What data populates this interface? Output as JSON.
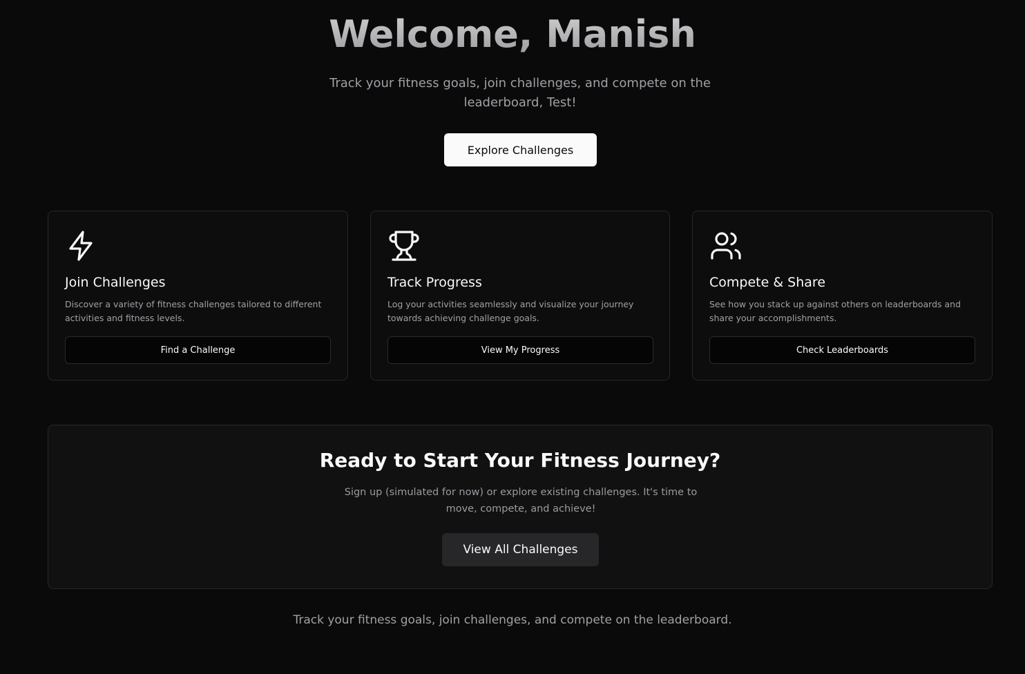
{
  "hero": {
    "title": "Welcome, Manish",
    "subtitle": "Track your fitness goals, join challenges, and compete on the leaderboard, Test!",
    "cta_label": "Explore Challenges"
  },
  "features": [
    {
      "icon": "lightning-icon",
      "title": "Join Challenges",
      "description": "Discover a variety of fitness challenges tailored to different activities and fitness levels.",
      "button_label": "Find a Challenge"
    },
    {
      "icon": "trophy-icon",
      "title": "Track Progress",
      "description": "Log your activities seamlessly and visualize your journey towards achieving challenge goals.",
      "button_label": "View My Progress"
    },
    {
      "icon": "users-icon",
      "title": "Compete & Share",
      "description": "See how you stack up against others on leaderboards and share your accomplishments.",
      "button_label": "Check Leaderboards"
    }
  ],
  "cta": {
    "title": "Ready to Start Your Fitness Journey?",
    "description": "Sign up (simulated for now) or explore existing challenges. It's time to move, compete, and achieve!",
    "button_label": "View All Challenges"
  },
  "footer": {
    "text": "Track your fitness goals, join challenges, and compete on the leaderboard."
  },
  "colors": {
    "background": "#0a0a0b",
    "card_background": "#0d0d0e",
    "border": "#27272a",
    "primary_button": "#fafafa",
    "secondary_button": "#27272a",
    "muted_text": "#a1a1a6"
  }
}
